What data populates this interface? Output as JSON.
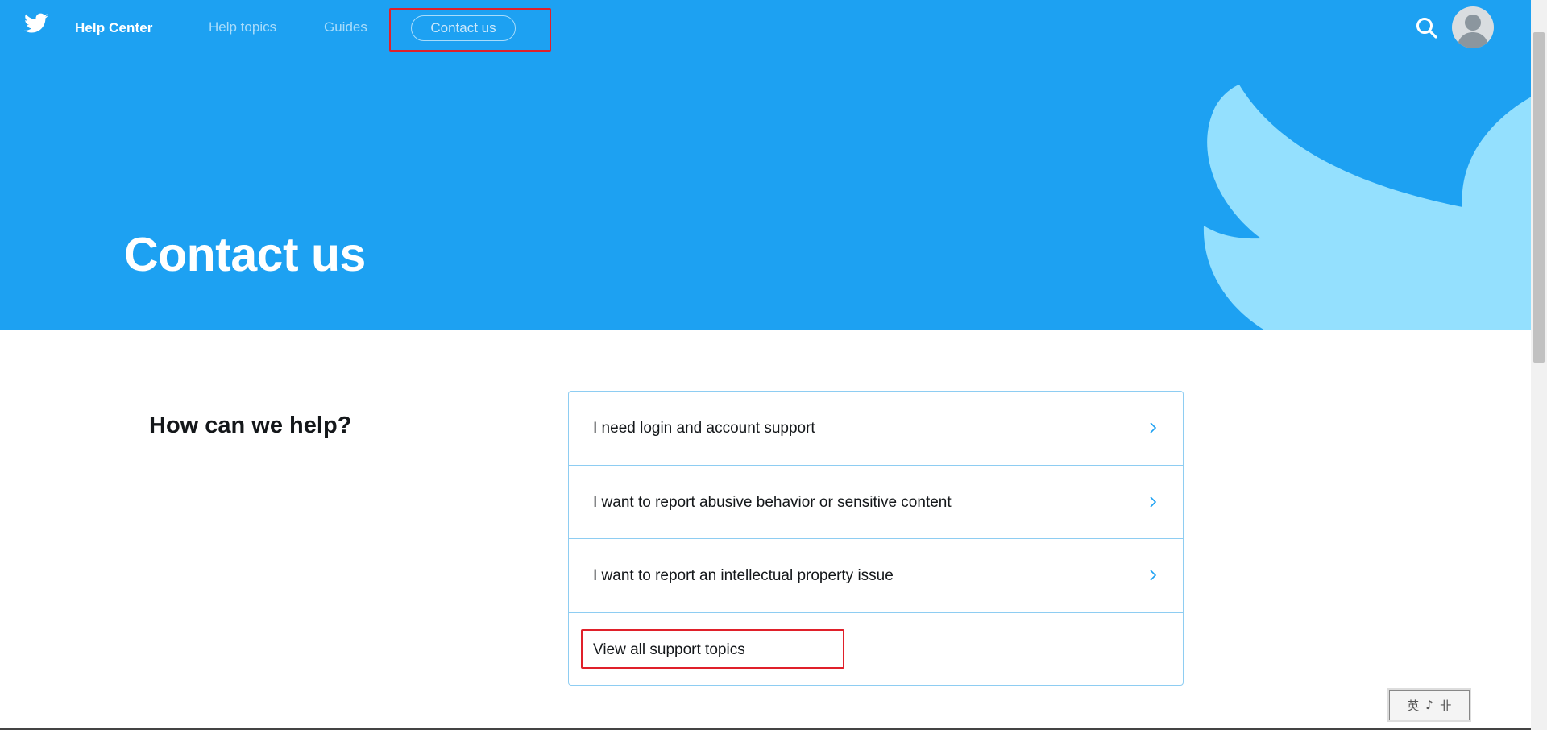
{
  "header": {
    "brand": "Help Center",
    "nav": {
      "help_topics": "Help topics",
      "guides": "Guides",
      "contact_us": "Contact us"
    },
    "icons": {
      "logo": "twitter-bird-icon",
      "search": "search-icon",
      "avatar": "user-avatar"
    }
  },
  "hero": {
    "title": "Contact us"
  },
  "main": {
    "heading": "How can we help?",
    "options": [
      {
        "label": "I need login and account support",
        "icon": "chevron-right-icon"
      },
      {
        "label": "I want to report abusive behavior or sensitive content",
        "icon": "chevron-right-icon"
      },
      {
        "label": "I want to report an intellectual property issue",
        "icon": "chevron-right-icon"
      },
      {
        "label": "View all support topics"
      }
    ]
  },
  "ime": {
    "chars": [
      "英",
      "♪",
      "卝"
    ]
  },
  "colors": {
    "hero_bg": "#1da1f2",
    "hero_bird": "#94e0fe",
    "border": "#8ecdf2",
    "highlight": "#e0202a"
  }
}
